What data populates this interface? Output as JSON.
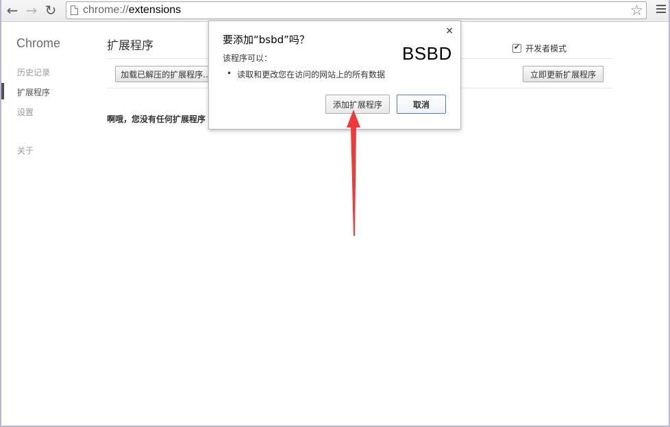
{
  "toolbar": {
    "back_icon": "arrow-left-icon",
    "forward_icon": "arrow-right-icon",
    "reload_icon": "reload-icon",
    "url_scheme": "chrome://",
    "url_path": "extensions",
    "star_icon": "star-icon",
    "menu_icon": "hamburger-menu-icon"
  },
  "sidebar": {
    "brand": "Chrome",
    "items": [
      {
        "label": "历史记录"
      },
      {
        "label": "扩展程序"
      },
      {
        "label": "设置"
      },
      {
        "label": "关于"
      }
    ],
    "active_index": 1
  },
  "main": {
    "title": "扩展程序",
    "dev_mode_label": "开发者模式",
    "dev_mode_checked": true,
    "load_unpacked_label": "加载已解压的扩展程序...",
    "update_label": "立即更新扩展程序",
    "empty_message": "啊哦，您没有任何扩展程序 :"
  },
  "dialog": {
    "title": "要添加“bsbd”吗？",
    "subtitle": "该程序可以：",
    "permissions": [
      "读取和更改您在访问的网站上的所有数据"
    ],
    "logo_text": "BSBD",
    "add_label": "添加扩展程序",
    "cancel_label": "取消",
    "close_label": "×"
  },
  "colors": {
    "frame": "#b9b3d6",
    "arrow": "#f03a3a",
    "primary_border": "#4b7fc2"
  }
}
